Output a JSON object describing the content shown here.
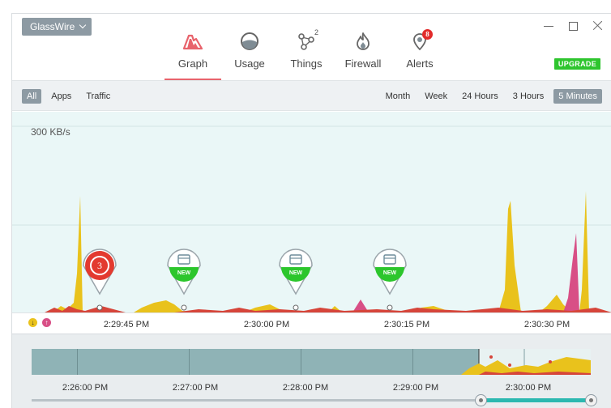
{
  "app": {
    "name": "GlassWire"
  },
  "tabs": [
    {
      "label": "Graph",
      "icon": "graph-icon",
      "active": true
    },
    {
      "label": "Usage",
      "icon": "usage-icon"
    },
    {
      "label": "Things",
      "icon": "things-icon",
      "badge": "2"
    },
    {
      "label": "Firewall",
      "icon": "firewall-icon"
    },
    {
      "label": "Alerts",
      "icon": "alerts-icon",
      "badge": "8"
    }
  ],
  "upgrade_label": "UPGRADE",
  "filters": {
    "left": [
      "All",
      "Apps",
      "Traffic"
    ],
    "left_selected": "All",
    "right": [
      "Month",
      "Week",
      "24 Hours",
      "3 Hours",
      "5 Minutes"
    ],
    "right_selected": "5 Minutes"
  },
  "graph": {
    "scale": "300 KB/s",
    "markers": [
      {
        "type": "alert",
        "label": "3"
      },
      {
        "type": "new-app",
        "label": "NEW"
      },
      {
        "type": "new-app",
        "label": "NEW"
      },
      {
        "type": "new-app",
        "label": "NEW"
      }
    ],
    "time_labels": [
      "2:29:45 PM",
      "2:30:00 PM",
      "2:30:15 PM",
      "2:30:30 PM"
    ]
  },
  "overview": {
    "time_labels": [
      "2:26:00 PM",
      "2:27:00 PM",
      "2:28:00 PM",
      "2:29:00 PM",
      "2:30:00 PM"
    ]
  },
  "colors": {
    "download": "#e9c21c",
    "upload": "#d84f86",
    "accent": "#e8636c",
    "upgrade": "#2ec52e",
    "selection": "#8d9aa3"
  }
}
